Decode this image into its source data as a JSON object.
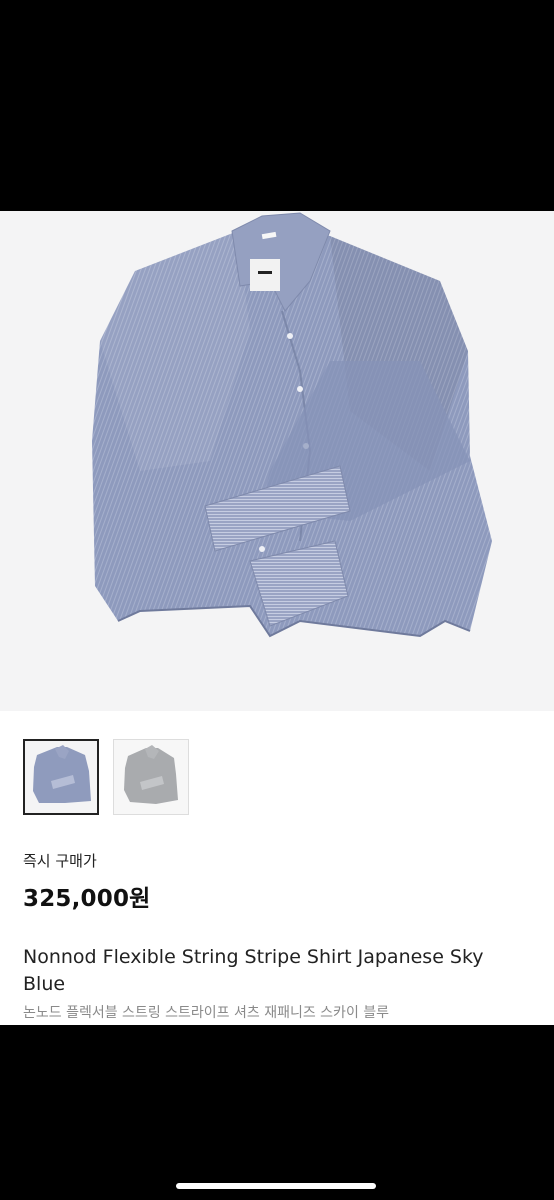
{
  "product": {
    "price_label": "즉시 구매가",
    "price": "325,000원",
    "title": "Nonnod Flexible String Stripe Shirt Japanese Sky Blue",
    "subtitle": "논노드 플렉서블 스트링 스트라이프 셔츠 재패니즈 스카이 블루"
  },
  "gallery": {
    "selected_index": 0,
    "thumbnail_count": 2
  },
  "colors": {
    "shirt_blue": "#8f9bbd",
    "shirt_gray": "#a9abae",
    "hero_bg": "#f4f4f5"
  }
}
